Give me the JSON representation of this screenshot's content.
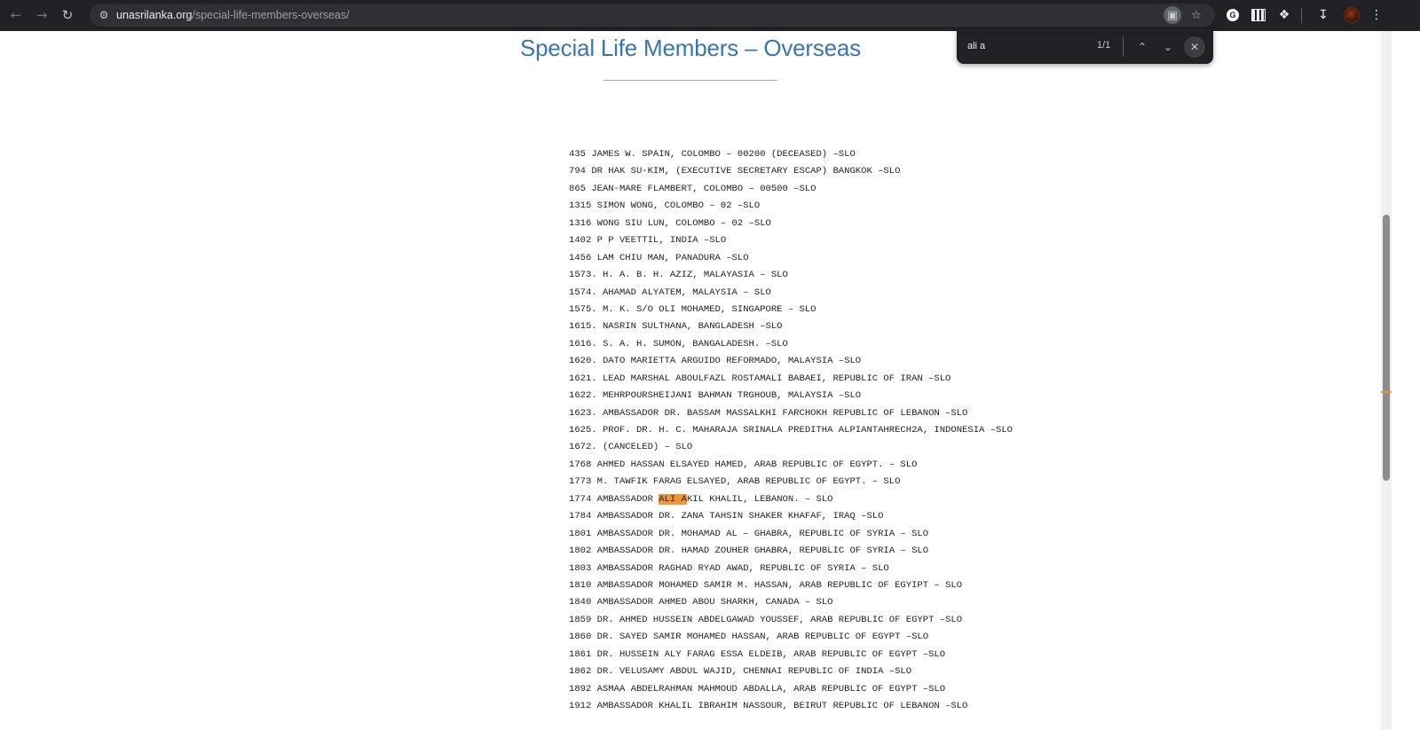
{
  "browser": {
    "url_domain": "unasrilanka.org",
    "url_path": "/special-life-members-overseas/",
    "icons": {
      "back": "back-arrow-icon",
      "forward": "forward-arrow-icon",
      "reload": "reload-icon",
      "site_info": "site-info-icon",
      "lens": "google-lens-icon",
      "bookmark": "star-icon",
      "extensions": "puzzle-icon",
      "download": "download-icon",
      "menu": "kebab-menu-icon"
    }
  },
  "find_bar": {
    "query": "ali a",
    "count": "1/1",
    "icons": {
      "prev": "chevron-up-icon",
      "next": "chevron-down-icon",
      "close": "close-icon"
    }
  },
  "page": {
    "title": "Special Life Members – Overseas",
    "members": [
      "435 JAMES W. SPAIN, COLOMBO – 00200 (DECEASED) –SLO",
      "794 DR HAK SU-KIM, (EXECUTIVE SECRETARY ESCAP) BANGKOK –SLO",
      "865 JEAN-MARE FLAMBERT, COLOMBO – 00500 –SLO",
      "1315 SIMON WONG, COLOMBO – 02 –SLO",
      "1316 WONG SIU LUN, COLOMBO – 02 –SLO",
      "1402 P P VEETTIL, INDIA –SLO",
      "1456 LAM CHIU MAN, PANADURA –SLO",
      "1573. H. A. B. H. AZIZ, MALAYASIA – SLO",
      "1574. AHAMAD ALYATEM, MALAYSIA – SLO",
      "1575. M. K. S/O OLI MOHAMED, SINGAPORE – SLO",
      "1615. NASRIN SULTHANA, BANGLADESH –SLO",
      "1616. S. A. H. SUMON, BANGALADESH. –SLO",
      "1620. DATO MARIETTA ARGUIDO REFORMADO, MALAYSIA –SLO",
      "1621. LEAD MARSHAL ABOULFAZL ROSTAMALI BABAEI, REPUBLIC OF IRAN –SLO",
      "1622. MEHRPOURSHEIJANI BAHMAN TRGHOUB, MALAYSIA –SLO",
      "1623. AMBASSADOR DR. BASSAM MASSALKHI FARCHOKH REPUBLIC OF LEBANON –SLO",
      "1625. PROF. DR. H. C. MAHARAJA SRINALA PREDITHA ALPIANTAHRECH2A, INDONESIA –SLO",
      "1672. (CANCELED) – SLO",
      "1768 AHMED HASSAN ELSAYED HAMED, ARAB REPUBLIC OF EGYPT. – SLO",
      "1773 M. TAWFIK FARAG ELSAYED, ARAB REPUBLIC OF EGYPT. – SLO",
      "1774 AMBASSADOR ALI AKIL KHALIL, LEBANON. – SLO",
      "1784 AMBASSADOR DR. ZANA TAHSIN SHAKER KHAFAF, IRAQ –SLO",
      "1801 AMBASSADOR DR. MOHAMAD AL – GHABRA, REPUBLIC OF SYRIA – SLO",
      "1802 AMBASSADOR DR. HAMAD ZOUHER GHABRA, REPUBLIC OF SYRIA – SLO",
      "1803 AMBASSADOR RAGHAD RYAD AWAD, REPUBLIC OF SYRIA – SLO",
      "1810 AMBASSADOR MOHAMED SAMIR M. HASSAN, ARAB REPUBLIC OF EGYIPT – SLO",
      "1840 AMBASSADOR AHMED ABOU SHARKH, CANADA – SLO",
      "1859 DR. AHMED HUSSEIN ABDELGAWAD YOUSSEF, ARAB REPUBLIC OF EGYPT –SLO",
      "1860 DR. SAYED SAMIR MOHAMED HASSAN, ARAB REPUBLIC OF EGYPT –SLO",
      "1861 DR. HUSSEIN ALY FARAG ESSA ELDEIB, ARAB REPUBLIC OF EGYPT –SLO",
      "1862 DR. VELUSAMY ABDUL WAJID, CHENNAI REPUBLIC OF INDIA –SLO",
      "1892 ASMAA ABDELRAHMAN MAHMOUD ABDALLA, ARAB REPUBLIC OF EGYPT –SLO",
      "1912 AMBASSADOR KHALIL IBRAHIM NASSOUR, BEIRUT REPUBLIC OF LEBANON –SLO"
    ],
    "highlight_row_index": 20,
    "highlight_text": "ALI A"
  },
  "colors": {
    "title": "#3776b0",
    "find_highlight": "#f29535",
    "chrome_bg": "#202124"
  }
}
